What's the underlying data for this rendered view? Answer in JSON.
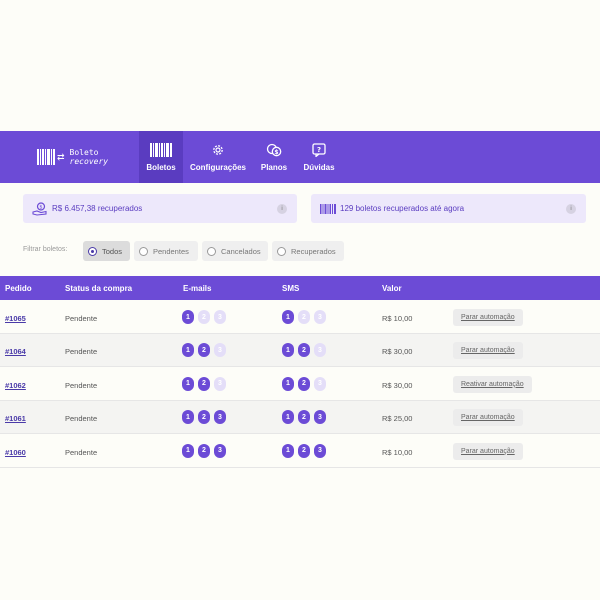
{
  "brand": {
    "line1": "Boleto",
    "line2": "recovery",
    "arrows": "⇄"
  },
  "nav": [
    {
      "label": "Boletos",
      "icon": "barcode-icon"
    },
    {
      "label": "Configurações",
      "icon": "gear-icon"
    },
    {
      "label": "Planos",
      "icon": "coins-icon"
    },
    {
      "label": "Dúvidas",
      "icon": "question-icon"
    }
  ],
  "stats": {
    "recovered_amount": "R$ 6.457,38",
    "recovered_amount_suffix": " recuperados",
    "recovered_count": "129",
    "recovered_count_suffix": " boletos recuperados até agora",
    "info_glyph": "i"
  },
  "filter": {
    "label": "Filtrar boletos:",
    "options": [
      "Todos",
      "Pendentes",
      "Cancelados",
      "Recuperados"
    ],
    "selected": "Todos"
  },
  "table": {
    "headers": [
      "Pedido",
      "Status da compra",
      "E-mails",
      "SMS",
      "Valor"
    ],
    "rows": [
      {
        "order": "#1065",
        "status": "Pendente",
        "emails": [
          1,
          2,
          3
        ],
        "emails_sent": 1,
        "sms": [
          1,
          2,
          3
        ],
        "sms_sent": 1,
        "value": "R$ 10,00",
        "action": "Parar automação"
      },
      {
        "order": "#1064",
        "status": "Pendente",
        "emails": [
          1,
          2,
          3
        ],
        "emails_sent": 2,
        "sms": [
          1,
          2,
          3
        ],
        "sms_sent": 2,
        "value": "R$ 30,00",
        "action": "Parar automação"
      },
      {
        "order": "#1062",
        "status": "Pendente",
        "emails": [
          1,
          2,
          3
        ],
        "emails_sent": 2,
        "sms": [
          1,
          2,
          3
        ],
        "sms_sent": 2,
        "value": "R$ 30,00",
        "action": "Reativar automação"
      },
      {
        "order": "#1061",
        "status": "Pendente",
        "emails": [
          1,
          2,
          3
        ],
        "emails_sent": 3,
        "sms": [
          1,
          2,
          3
        ],
        "sms_sent": 3,
        "value": "R$ 25,00",
        "action": "Parar automação"
      },
      {
        "order": "#1060",
        "status": "Pendente",
        "emails": [
          1,
          2,
          3
        ],
        "emails_sent": 3,
        "sms": [
          1,
          2,
          3
        ],
        "sms_sent": 3,
        "value": "R$ 10,00",
        "action": "Parar automação"
      }
    ]
  },
  "colors": {
    "primary": "#6c4bd6",
    "primary_dark": "#5a3cc0",
    "dot_inactive": "#e4def8",
    "card_bg": "#ede8fb"
  }
}
